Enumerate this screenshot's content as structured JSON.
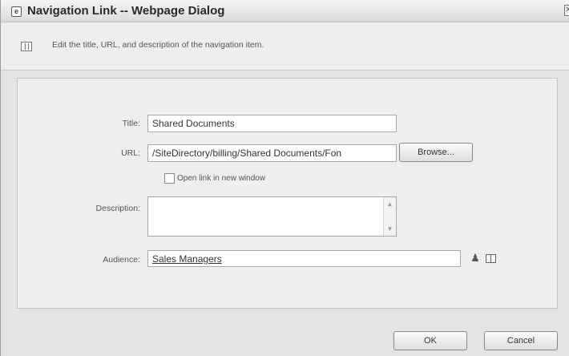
{
  "window": {
    "title": "Navigation Link -- Webpage Dialog",
    "close_glyph": "✕"
  },
  "header": {
    "description": "Edit the title, URL, and description of the navigation item."
  },
  "form": {
    "title_label": "Title:",
    "title_value": "Shared Documents",
    "url_label": "URL:",
    "url_value": "/SiteDirectory/billing/Shared Documents/Fon",
    "browse_label": "Browse...",
    "open_new_window_label": "Open link in new window",
    "open_new_window_checked": false,
    "description_label": "Description:",
    "description_value": "",
    "audience_label": "Audience:",
    "audience_value": "Sales Managers"
  },
  "icons": {
    "title_icon": "page-icon",
    "header_icon": "list-icon",
    "people_icon": "people-picker-icon",
    "browse_icon": "address-book-icon"
  },
  "footer": {
    "ok_label": "OK",
    "cancel_label": "Cancel"
  }
}
